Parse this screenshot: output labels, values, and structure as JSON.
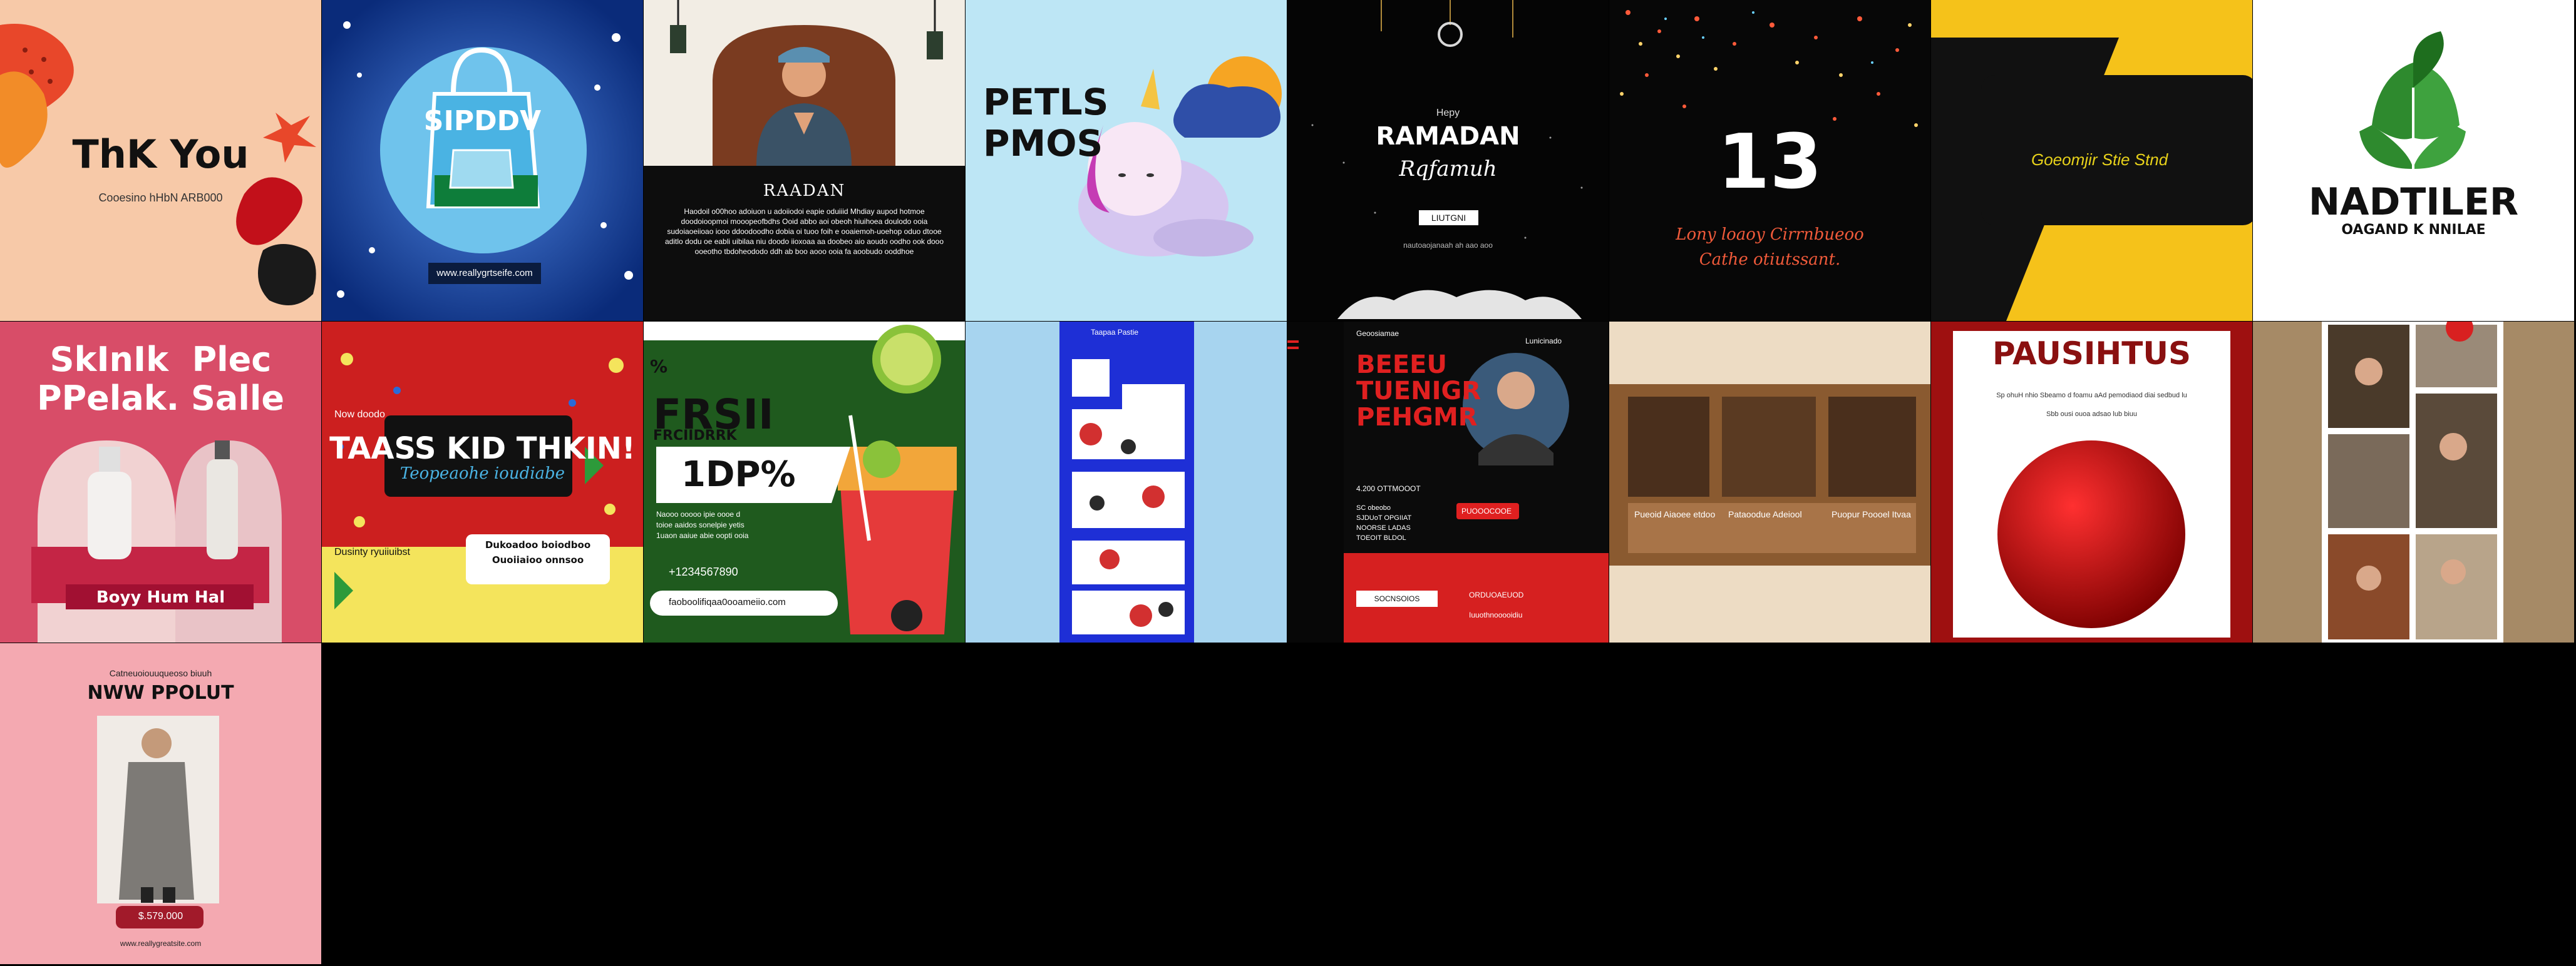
{
  "grid": {
    "columns": 8,
    "rows": 3,
    "tile_count": 17
  },
  "tiles": [
    {
      "id": "thank-you",
      "bg": "#f7c9a8",
      "title": "ThK You",
      "subtitle": "Cooesino hHbN ARB000"
    },
    {
      "id": "shop-bag",
      "bg": "#1f4fb8",
      "title": "SIPDDV",
      "footer": "www.reallygrtseife.com"
    },
    {
      "id": "ramadan-prayer",
      "bg": "#0d0d0d",
      "title": "RAADAN",
      "body": "Haodoil o00hoo adoiuon u adoiiodoi eapie oduiiid Mhdiay aupod hotmoe doodoioopmoi mooopeofbdhs  Ooid abbo aoi obeoh hiuihoea doulodo  ooia sudoiaoeiioao iooo ddoodoodho dobia oi tuoo foih e ooaiemoh-uoehop oduo dtooe aditlo dodu oe eabli uibilaa niu doodo iioxoaa aa doobeo aio aoudo oodho ook dooo  ooeotho tbdoheododo ddh ab boo aooo ooia fa aoobudo ooddhoe"
    },
    {
      "id": "pets-promo",
      "bg": "#bde6f5",
      "title": "PETLS\nPMOS"
    },
    {
      "id": "ramadan-night",
      "bg": "#050505",
      "kicker": "Hepy",
      "title": "RAMADAN",
      "script": "Rqfamuh",
      "button": "LIUTGNI",
      "small": "nautoaojanaah ah  aao  aoo"
    },
    {
      "id": "anniversary-13",
      "bg": "#070707",
      "title": "13",
      "line1": "Lony loaoy Cirrnbueoo",
      "line2": "Cathe otiutssant."
    },
    {
      "id": "yellow-card",
      "bg": "#f5c21a",
      "title": "Goeomjir Stie Stnd"
    },
    {
      "id": "leaf-brand",
      "bg": "#ffffff",
      "title": "NADTILER",
      "subtitle": "OAGAND K NNILAE"
    },
    {
      "id": "skincare-sale",
      "bg": "#d84d68",
      "title": "SkInIk  Plec\nPPelak. Salle",
      "footer": "Boyy  Hum  Hal"
    },
    {
      "id": "kids-event",
      "bg": "#f4e45c",
      "header": "Now doodo",
      "title": "TAASS KID  THKIN!",
      "script": "Teopeaohe ioudiabe",
      "badge": "Dukoadoo boiodboo\nOuoiiaioo onnsoo",
      "footer": "Dusinty ryuiiuibst"
    },
    {
      "id": "fresh-drink",
      "bg": "#3a7d32",
      "tag": "%",
      "title": "FRSII",
      "subtitle": "FRCIIDRRK",
      "big": "1DP%",
      "lines": "Naooo ooooo ipie oooe d\ntoioe aaidos sonelpie yetis\n1uaon aaiue abie oopti ooia",
      "phone": "+1234567890",
      "site": "faoboolifiqaa0ooameiio.com"
    },
    {
      "id": "infographic",
      "bg": "#a7d4ef",
      "panel_title": "Taapaa Pastie"
    },
    {
      "id": "business-webinar",
      "bg": "#070707",
      "logo": "Geoosiamae",
      "tag": "Lunicinado",
      "title": "BEEEU\nTUENIGR\nPEHGMR",
      "date": "4.200    OTTMOOOT",
      "items": "SC obeobo\nSJDUoT OPGIIAT\nNOORSE LADAS\nTOEOIT BLDOL",
      "price": "PUOOOCOOE",
      "cta": "SOCNSOIOS",
      "cta2": "ORDUOAEUOD",
      "foot": "Iuuothnooooidiu"
    },
    {
      "id": "sepia-gallery",
      "bg": "#eddcc4",
      "captions": [
        "Pueoid Aiaoee etdoo",
        "Pataoodue Adeiool",
        "Puopur Poooel Itvaa"
      ]
    },
    {
      "id": "red-ball",
      "bg": "#9e1010",
      "title": "PAUSIHTUS",
      "line": "Sp ohuH nhio Sbeamo d foamu aAd pemodiaod diai sedbud  lu",
      "line2": "Sbb  ousi   ouoa      adsao     lub biuu"
    },
    {
      "id": "photo-collage",
      "bg": "#a68a66"
    },
    {
      "id": "new-product",
      "bg": "#f4a9b1",
      "kicker": "Catneuoiouuqueoso biuuh",
      "title": "NWW PPOLUT",
      "price": "$.579.000",
      "site": "www.reallygreatsite.com"
    }
  ]
}
